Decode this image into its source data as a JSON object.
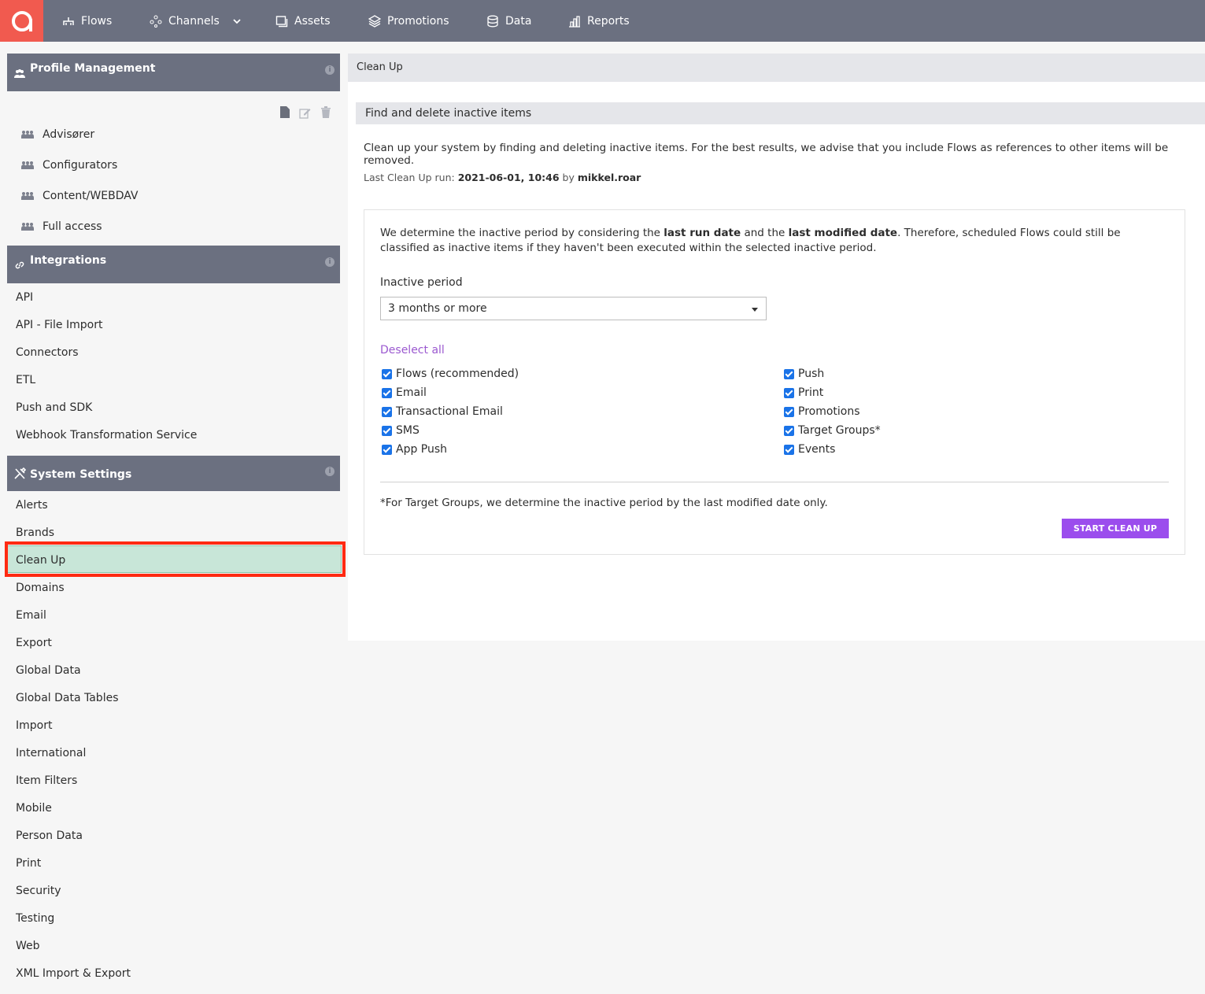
{
  "topnav": {
    "items": [
      {
        "label": "Flows",
        "icon": "flows-icon"
      },
      {
        "label": "Channels",
        "icon": "channels-icon"
      },
      {
        "label": "Assets",
        "icon": "assets-icon"
      },
      {
        "label": "Promotions",
        "icon": "promotions-icon"
      },
      {
        "label": "Data",
        "icon": "data-icon"
      },
      {
        "label": "Reports",
        "icon": "reports-icon"
      }
    ],
    "bg_color": "#6b7080",
    "logo_color": "#f15a4f"
  },
  "sidebar": {
    "profile_management": {
      "title": "Profile Management",
      "items": [
        "Advisører",
        "Configurators",
        "Content/WEBDAV",
        "Full access"
      ]
    },
    "integrations": {
      "title": "Integrations",
      "items": [
        "API",
        "API - File Import",
        "Connectors",
        "ETL",
        "Push and SDK",
        "Webhook Transformation Service"
      ]
    },
    "system_settings": {
      "title": "System Settings",
      "items": [
        "Alerts",
        "Brands",
        "Clean Up",
        "Domains",
        "Email",
        "Export",
        "Global Data",
        "Global Data Tables",
        "Import",
        "International",
        "Item Filters",
        "Mobile",
        "Person Data",
        "Print",
        "Security",
        "Testing",
        "Web",
        "XML Import & Export"
      ],
      "selected": "Clean Up"
    },
    "info_glyph": "i"
  },
  "main": {
    "breadcrumb": "Clean Up",
    "section_title": "Find and delete inactive items",
    "description": "Clean up your system by finding and deleting inactive items. For the best results, we advise that you include Flows as references to other items will be removed.",
    "last_run": {
      "prefix": "Last Clean Up run:",
      "datetime": "2021-06-01, 10:46",
      "by": "by",
      "user": "mikkel.roar"
    },
    "card": {
      "text_1": "We determine the inactive period by considering the ",
      "bold_1": "last run date",
      "text_2": " and the ",
      "bold_2": "last modified date",
      "text_3": ". Therefore, scheduled Flows could still be classified as inactive items if they haven't been executed within the selected inactive period.",
      "period_label": "Inactive period",
      "period_value": "3 months or more",
      "deselect_label": "Deselect all",
      "left_checks": [
        "Flows (recommended)",
        "Email",
        "Transactional Email",
        "SMS",
        "App Push"
      ],
      "right_checks": [
        "Push",
        "Print",
        "Promotions",
        "Target Groups*",
        "Events"
      ],
      "footnote": "*For Target Groups, we determine the inactive period by the last modified date only.",
      "start_button": "START CLEAN UP"
    },
    "accent_color": "#9b4ded"
  }
}
